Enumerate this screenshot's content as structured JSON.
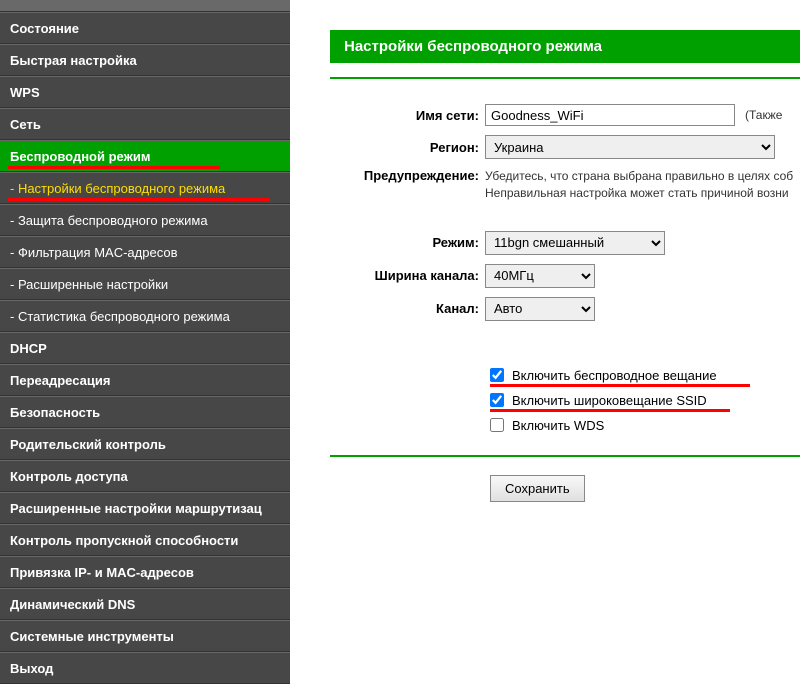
{
  "sidebar": {
    "items": [
      {
        "label": "Состояние",
        "type": "main"
      },
      {
        "label": "Быстрая настройка",
        "type": "main"
      },
      {
        "label": "WPS",
        "type": "main"
      },
      {
        "label": "Сеть",
        "type": "main"
      },
      {
        "label": "Беспроводной режим",
        "type": "main-active"
      },
      {
        "label": "- Настройки беспроводного режима",
        "type": "sub-active"
      },
      {
        "label": "- Защита беспроводного режима",
        "type": "sub"
      },
      {
        "label": "- Фильтрация MAC-адресов",
        "type": "sub"
      },
      {
        "label": "- Расширенные настройки",
        "type": "sub"
      },
      {
        "label": "- Статистика беспроводного режима",
        "type": "sub"
      },
      {
        "label": "DHCP",
        "type": "main"
      },
      {
        "label": "Переадресация",
        "type": "main"
      },
      {
        "label": "Безопасность",
        "type": "main"
      },
      {
        "label": "Родительский контроль",
        "type": "main"
      },
      {
        "label": "Контроль доступа",
        "type": "main"
      },
      {
        "label": "Расширенные настройки маршрутизац",
        "type": "main"
      },
      {
        "label": "Контроль пропускной способности",
        "type": "main"
      },
      {
        "label": "Привязка IP- и MAC-адресов",
        "type": "main"
      },
      {
        "label": "Динамический DNS",
        "type": "main"
      },
      {
        "label": "Системные инструменты",
        "type": "main"
      },
      {
        "label": "Выход",
        "type": "main"
      }
    ]
  },
  "page": {
    "title": "Настройки беспроводного режима",
    "labels": {
      "ssid": "Имя сети:",
      "region": "Регион:",
      "warning": "Предупреждение:",
      "mode": "Режим:",
      "channel_width": "Ширина канала:",
      "channel": "Канал:"
    },
    "values": {
      "ssid": "Goodness_WiFi",
      "ssid_after": "(Также",
      "region": "Украина",
      "warning_text1": "Убедитесь, что страна выбрана правильно в целях соб",
      "warning_text2": "Неправильная настройка может стать причиной возни",
      "mode": "11bgn смешанный",
      "channel_width": "40МГц",
      "channel": "Авто"
    },
    "checkboxes": {
      "enable_wireless": {
        "label": "Включить беспроводное вещание",
        "checked": true
      },
      "enable_ssid": {
        "label": "Включить широковещание SSID",
        "checked": true
      },
      "enable_wds": {
        "label": "Включить WDS",
        "checked": false
      }
    },
    "buttons": {
      "save": "Сохранить"
    }
  }
}
